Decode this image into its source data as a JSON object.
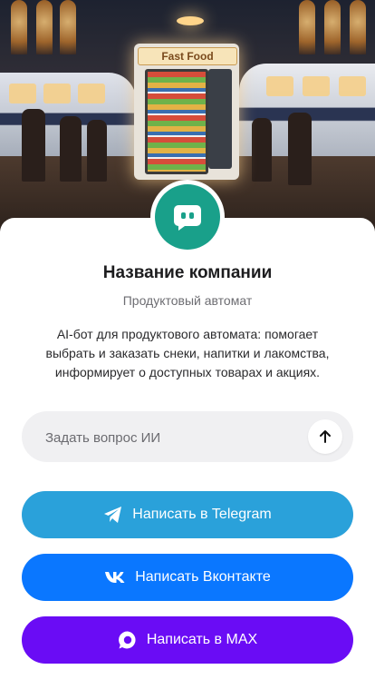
{
  "hero": {
    "vending_sign": "Fast Food"
  },
  "company": {
    "name": "Название компании",
    "subtitle": "Продуктовый автомат",
    "description": "AI-бот для продуктового автомата: помогает выбрать и заказать снеки, напитки и лакомства, информирует о доступных товарах и акциях."
  },
  "ask": {
    "placeholder": "Задать вопрос ИИ",
    "value": ""
  },
  "buttons": {
    "telegram": "Написать в Telegram",
    "vk": "Написать Вконтакте",
    "max": "Написать в MAX"
  },
  "colors": {
    "avatar": "#19a08a",
    "telegram": "#2aa1da",
    "vk": "#0a77ff",
    "max": "#6a0cf5"
  },
  "icons": {
    "avatar": "chat-bot-icon",
    "send": "arrow-up-icon",
    "telegram": "telegram-icon",
    "vk": "vk-icon",
    "max": "max-icon"
  }
}
